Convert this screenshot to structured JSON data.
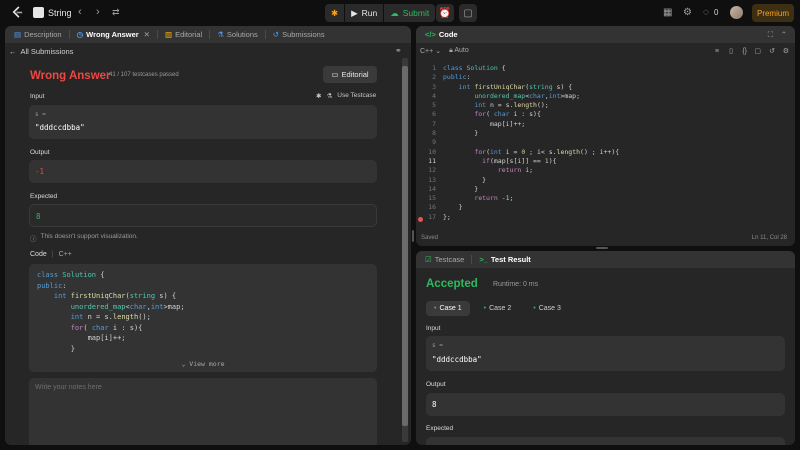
{
  "topbar": {
    "problem_title": "String",
    "run_label": "Run",
    "submit_label": "Submit",
    "streak_count": "0",
    "premium_label": "Premium"
  },
  "left_tabs": [
    {
      "label": "Description"
    },
    {
      "label": "Wrong Answer"
    },
    {
      "label": "Editorial"
    },
    {
      "label": "Solutions"
    },
    {
      "label": "Submissions"
    }
  ],
  "back_link": "All Submissions",
  "result": {
    "title": "Wrong Answer",
    "passed": "41 / 107 testcases passed",
    "editorial_button": "Editorial",
    "input_label": "Input",
    "use_testcase": "Use Testcase",
    "input_var": "s =",
    "input_value": "\"dddccdbba\"",
    "output_label": "Output",
    "output_value": "-1",
    "expected_label": "Expected",
    "expected_value": "8",
    "viz_note": "This doesn't support visualization."
  },
  "code_header": {
    "label": "Code",
    "language": "C++"
  },
  "view_more": "View more",
  "notes_placeholder": "Write your notes here",
  "editor": {
    "title": "Code",
    "language": "C++",
    "mode": "Auto",
    "status_left": "Saved",
    "status_right": "Ln 11, Col 28",
    "line_numbers": [
      "1",
      "2",
      "3",
      "4",
      "5",
      "6",
      "7",
      "8",
      "9",
      "10",
      "11",
      "12",
      "13",
      "14",
      "15",
      "16",
      "17"
    ]
  },
  "testcase_tabs": [
    {
      "label": "Testcase"
    },
    {
      "label": "Test Result"
    }
  ],
  "test_result": {
    "status": "Accepted",
    "runtime": "Runtime: 0 ms",
    "cases": [
      {
        "label": "Case 1"
      },
      {
        "label": "Case 2"
      },
      {
        "label": "Case 3"
      }
    ],
    "input_label": "Input",
    "input_var": "s =",
    "input_value": "\"dddccdbba\"",
    "output_label": "Output",
    "output_value": "8",
    "expected_label": "Expected"
  },
  "colors": {
    "wrong": "#ef4743",
    "accepted": "#2cbb5d",
    "premium": "#ffa116"
  }
}
